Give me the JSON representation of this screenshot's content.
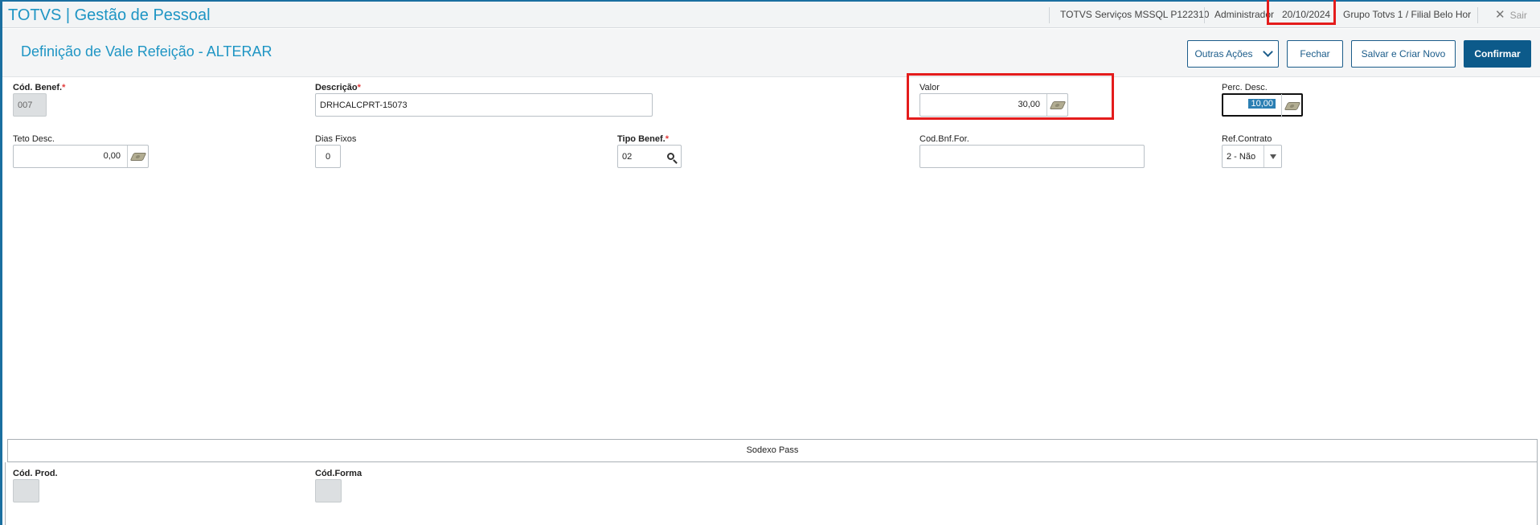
{
  "topbar": {
    "app_title": "TOTVS | Gestão de Pessoal",
    "environment": "TOTVS Serviços MSSQL P122310",
    "user": "Administrador",
    "date": "20/10/2024",
    "branch": "Grupo Totvs 1 / Filial Belo Hor",
    "exit_label": "Sair",
    "exit_icon": "close-icon"
  },
  "header": {
    "title": "Definição de Vale Refeição - ALTERAR",
    "buttons": {
      "other_actions": "Outras Ações",
      "close": "Fechar",
      "save_new": "Salvar e Criar Novo",
      "confirm": "Confirmar"
    }
  },
  "form": {
    "cod_benef": {
      "label": "Cód. Benef.",
      "value": "007",
      "required": "*"
    },
    "descricao": {
      "label": "Descrição",
      "value": "DRHCALCPRT-15073",
      "required": "*"
    },
    "valor": {
      "label": "Valor",
      "value": "30,00",
      "icon": "money-icon"
    },
    "perc_desc": {
      "label": "Perc. Desc.",
      "value": "10,00",
      "icon": "money-icon"
    },
    "teto_desc": {
      "label": "Teto Desc.",
      "value": "0,00",
      "icon": "money-icon"
    },
    "dias_fixos": {
      "label": "Dias Fixos",
      "value": "0"
    },
    "tipo_benef": {
      "label": "Tipo Benef.",
      "value": "02",
      "required": "*",
      "icon": "search-icon"
    },
    "cod_bnf_for": {
      "label": "Cod.Bnf.For.",
      "value": ""
    },
    "ref_contrato": {
      "label": "Ref.Contrato",
      "value": "2 - Não"
    }
  },
  "sodexo": {
    "title": "Sodexo Pass",
    "cod_prod": {
      "label": "Cód. Prod.",
      "value": ""
    },
    "cod_forma": {
      "label": "Cód.Forma",
      "value": ""
    }
  },
  "colors": {
    "accent": "#1e95c4",
    "primary_button": "#0c5a8a",
    "highlight": "#e41c1c"
  }
}
